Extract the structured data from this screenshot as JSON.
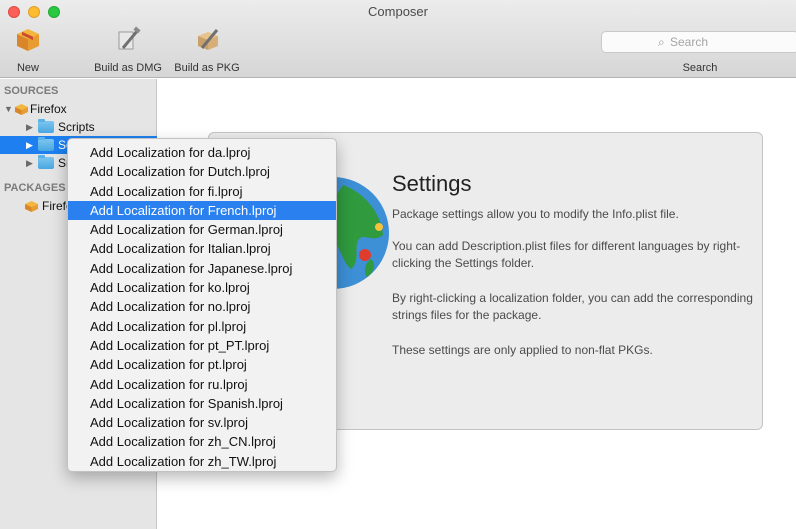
{
  "window": {
    "title": "Composer"
  },
  "toolbar": {
    "new_label": "New",
    "dmg_label": "Build as DMG",
    "pkg_label": "Build as PKG",
    "search_placeholder": "Search",
    "search_label": "Search"
  },
  "sidebar": {
    "sources_header": "SOURCES",
    "packages_header": "PACKAGES",
    "source_name": "Firefox",
    "items": [
      {
        "label": "Scripts"
      },
      {
        "label": "Se"
      },
      {
        "label": "Sr"
      }
    ],
    "package_label": "Firefo"
  },
  "settings": {
    "title": "Settings",
    "paragraphs": [
      "Package settings allow you to modify the Info.plist file.",
      "You can add Description.plist files for different languages by right-clicking the Settings folder.",
      "By right-clicking a localization folder, you can add the corresponding strings files for the package.",
      "These settings are only applied to non-flat PKGs."
    ]
  },
  "context_menu": {
    "highlighted_index": 3,
    "items": [
      "Add Localization for da.lproj",
      "Add Localization for Dutch.lproj",
      "Add Localization for fi.lproj",
      "Add Localization for French.lproj",
      "Add Localization for German.lproj",
      "Add Localization for Italian.lproj",
      "Add Localization for Japanese.lproj",
      "Add Localization for ko.lproj",
      "Add Localization for no.lproj",
      "Add Localization for pl.lproj",
      "Add Localization for pt_PT.lproj",
      "Add Localization for pt.lproj",
      "Add Localization for ru.lproj",
      "Add Localization for Spanish.lproj",
      "Add Localization for sv.lproj",
      "Add Localization for zh_CN.lproj",
      "Add Localization for zh_TW.lproj"
    ]
  },
  "colors": {
    "selection": "#1e80f0",
    "menu_highlight": "#2a80ef",
    "close": "#fc5f57",
    "minimize": "#fdbc2e",
    "zoom": "#28c840"
  }
}
